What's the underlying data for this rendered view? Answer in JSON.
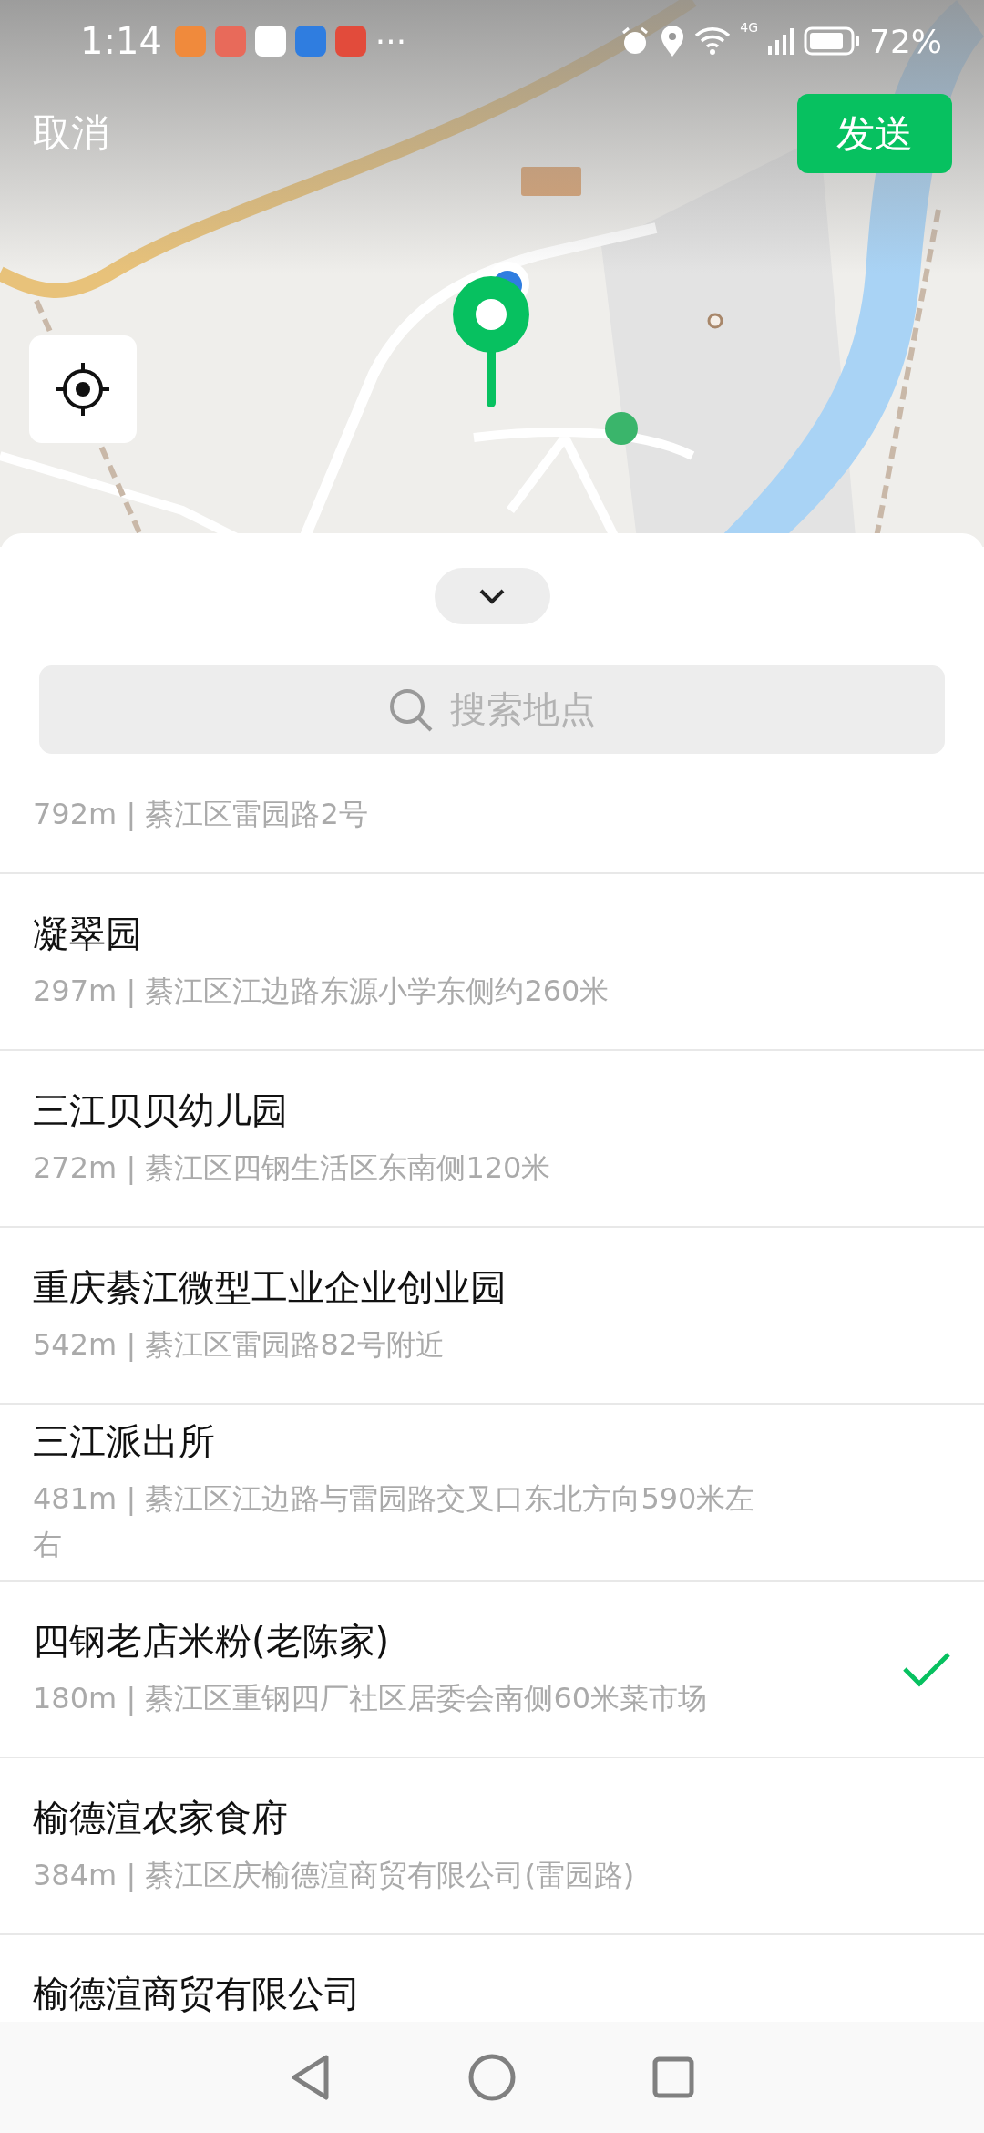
{
  "status_bar": {
    "time": "1:14",
    "more": "···",
    "network": "4G",
    "battery": "72%"
  },
  "header": {
    "cancel": "取消",
    "send": "发送"
  },
  "search": {
    "placeholder": "搜索地点"
  },
  "places": [
    {
      "detail": "792m | 綦江区雷园路2号",
      "selected": false
    },
    {
      "name": "凝翠园",
      "detail": "297m | 綦江区江边路东源小学东侧约260米",
      "selected": false
    },
    {
      "name": "三江贝贝幼儿园",
      "detail": "272m | 綦江区四钢生活区东南侧120米",
      "selected": false
    },
    {
      "name": "重庆綦江微型工业企业创业园",
      "detail": "542m | 綦江区雷园路82号附近",
      "selected": false
    },
    {
      "name": "三江派出所",
      "detail": "481m | 綦江区江边路与雷园路交叉口东北方向590米左右",
      "selected": false
    },
    {
      "name": "四钢老店米粉(老陈家)",
      "detail": "180m | 綦江区重钢四厂社区居委会南侧60米菜市场",
      "selected": true
    },
    {
      "name": "榆德渲农家食府",
      "detail": "384m | 綦江区庆榆德渲商贸有限公司(雷园路)",
      "selected": false
    },
    {
      "name": "榆德渲商贸有限公司",
      "selected": false
    }
  ]
}
